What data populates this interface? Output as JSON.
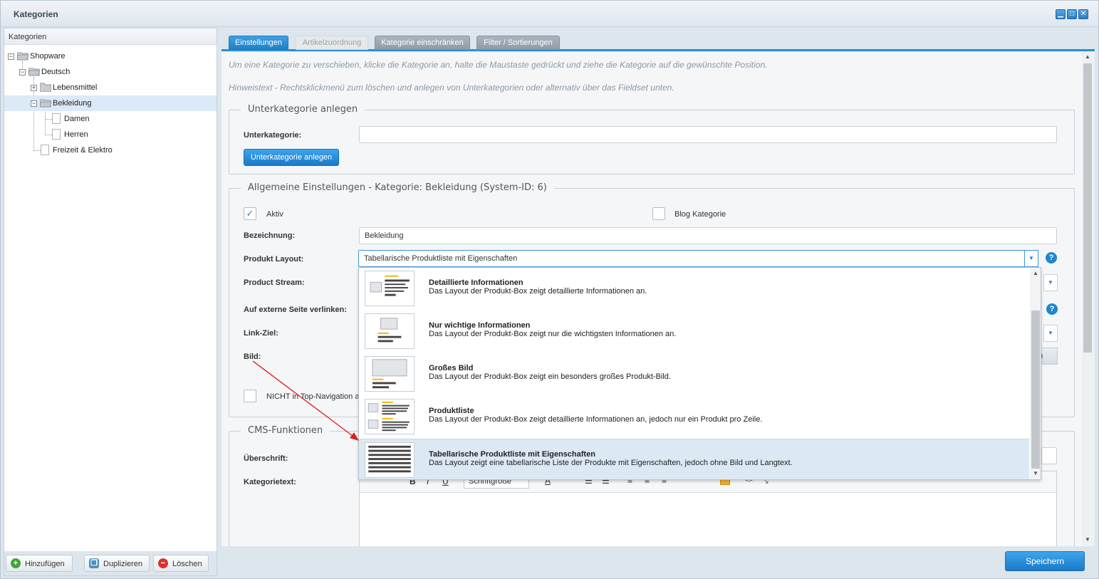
{
  "window": {
    "title": "Kategorien"
  },
  "left": {
    "header": "Kategorien",
    "tree": [
      {
        "label": "Shopware",
        "toggle": "−"
      },
      {
        "label": "Deutsch",
        "toggle": "−"
      },
      {
        "label": "Lebensmittel",
        "toggle": "+"
      },
      {
        "label": "Bekleidung",
        "toggle": "−"
      },
      {
        "label": "Damen"
      },
      {
        "label": "Herren"
      },
      {
        "label": "Freizeit & Elektro"
      }
    ],
    "buttons": {
      "add": "Hinzufügen",
      "duplicate": "Duplizieren",
      "delete": "Löschen"
    }
  },
  "tabs": [
    {
      "label": "Einstellungen"
    },
    {
      "label": "Artikelzuordnung"
    },
    {
      "label": "Kategorie einschränken"
    },
    {
      "label": "Filter / Sortierungen"
    }
  ],
  "hints": {
    "move": "Um eine Kategorie zu verschieben, klicke die Kategorie an, halte die Maustaste gedrückt und ziehe die Kategorie auf die gewünschte Position.",
    "context": "Hinweistext - Rechtsklickmenü zum löschen und anlegen von Unterkategorien oder alternativ über das Fieldset unten."
  },
  "sub": {
    "legend": "Unterkategorie anlegen",
    "label": "Unterkategorie:",
    "value": "",
    "button": "Unterkategorie anlegen"
  },
  "general": {
    "legend": "Allgemeine Einstellungen - Kategorie: Bekleidung (System-ID: 6)",
    "aktiv": "Aktiv",
    "aktiv_check": "✓",
    "blog": "Blog Kategorie",
    "bezeichnung_label": "Bezeichnung:",
    "bezeichnung_value": "Bekleidung",
    "layout_label": "Produkt Layout:",
    "layout_value": "Tabellarische Produktliste mit Eigenschaften",
    "stream_label": "Product Stream:",
    "extern_label": "Auf externe Seite verlinken:",
    "target_label": "Link-Ziel:",
    "bild_label": "Bild:",
    "bild_btn_partial": "en",
    "nav_label": "NICHT in Top-Navigation a"
  },
  "cms": {
    "legend": "CMS-Funktionen",
    "headline_label": "Überschrift:",
    "text_label": "Kategorietext:",
    "fontsize": "Schriftgröße"
  },
  "dropdown": [
    {
      "title": "Detaillierte Informationen",
      "desc": "Das Layout der Produkt-Box zeigt detaillierte Informationen an."
    },
    {
      "title": "Nur wichtige Informationen",
      "desc": "Das Layout der Produkt-Box zeigt nur die wichtigsten Informationen an."
    },
    {
      "title": "Großes Bild",
      "desc": "Das Layout der Produkt-Box zeigt ein besonders großes Produkt-Bild."
    },
    {
      "title": "Produktliste",
      "desc": "Das Layout der Produkt-Box zeigt detaillierte Informationen an, jedoch nur ein Produkt pro Zeile."
    },
    {
      "title": "Tabellarische Produktliste mit Eigenschaften",
      "desc": "Das Layout zeigt eine tabellarische Liste der Produkte mit Eigenschaften, jedoch ohne Bild und Langtext."
    }
  ],
  "save_button": "Speichern",
  "help_glyph": "?",
  "colors": {
    "accent": "#1f86d1",
    "annotation_arrow": "#e02020"
  }
}
